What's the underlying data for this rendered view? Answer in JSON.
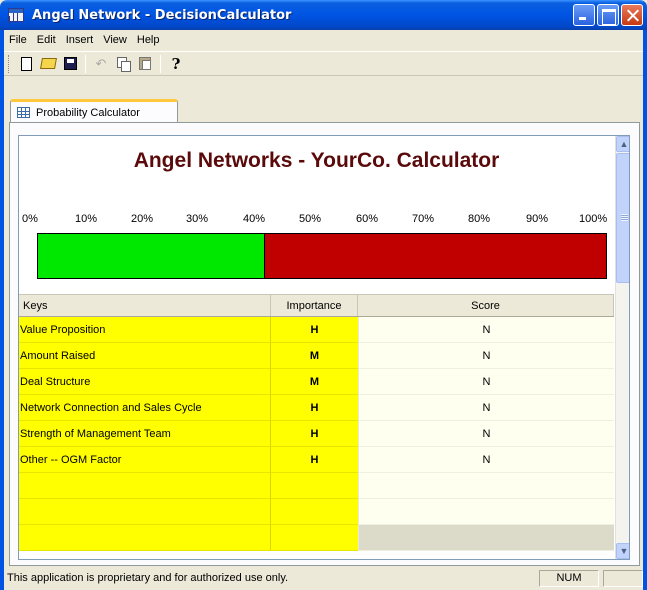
{
  "window": {
    "title": "Angel Network - DecisionCalculator"
  },
  "menu": [
    "File",
    "Edit",
    "Insert",
    "View",
    "Help"
  ],
  "toolbar": {
    "icons": [
      "new-icon",
      "open-icon",
      "save-icon",
      "undo-icon",
      "copy-icon",
      "paste-icon",
      "help-icon"
    ]
  },
  "tabs": [
    {
      "label": "Probability Calculator",
      "active": true
    }
  ],
  "calculator": {
    "heading": "Angel Networks - YourCo. Calculator",
    "scale_labels": [
      "0%",
      "10%",
      "20%",
      "30%",
      "40%",
      "50%",
      "60%",
      "70%",
      "80%",
      "90%",
      "100%"
    ],
    "probability_fraction": 0.4,
    "bar_colors": {
      "filled": "#00e800",
      "remaining": "#c00000"
    }
  },
  "grid": {
    "headers": {
      "keys": "Keys",
      "importance": "Importance",
      "score": "Score"
    },
    "rows": [
      {
        "key": "Value Proposition",
        "importance": "H",
        "score": "N"
      },
      {
        "key": "Amount Raised",
        "importance": "M",
        "score": "N"
      },
      {
        "key": "Deal Structure",
        "importance": "M",
        "score": "N"
      },
      {
        "key": "Network Connection and Sales Cycle",
        "importance": "H",
        "score": "N"
      },
      {
        "key": "Strength of Management Team",
        "importance": "H",
        "score": "N"
      },
      {
        "key": "Other -- OGM Factor",
        "importance": "H",
        "score": "N"
      },
      {
        "key": "",
        "importance": "",
        "score": ""
      },
      {
        "key": "",
        "importance": "",
        "score": ""
      },
      {
        "key": "",
        "importance": "",
        "score": ""
      }
    ],
    "colors": {
      "key_fill": "#ffff00",
      "score_fill": "#fffff0"
    }
  },
  "status": {
    "text": "This application is proprietary and for authorized use only.",
    "num": "NUM"
  }
}
